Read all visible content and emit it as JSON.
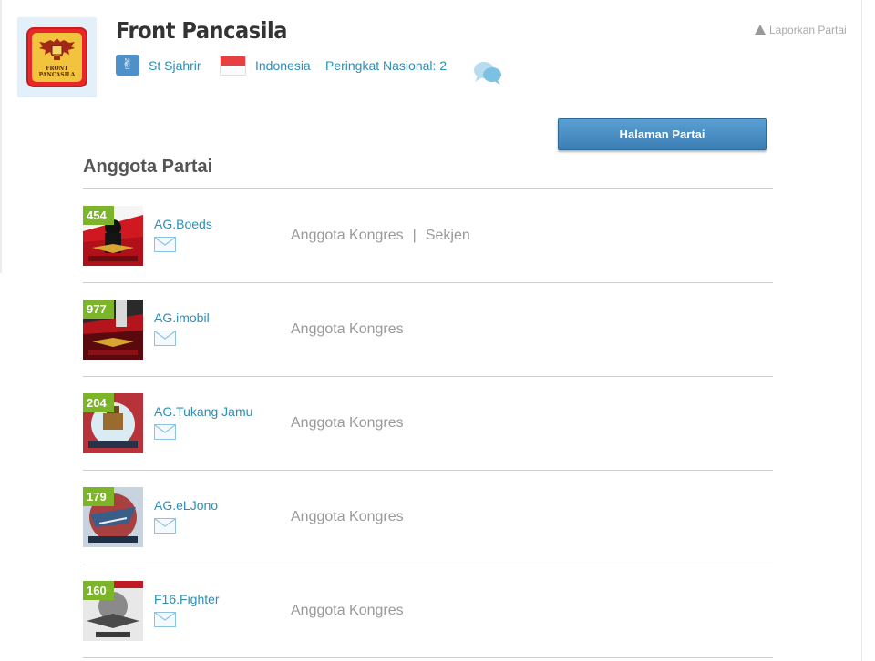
{
  "party": {
    "name": "Front Pancasila",
    "logo_text_line1": "FRONT",
    "logo_text_line2": "PANCASILA",
    "ideology_label": "St Sjahrir",
    "country_label": "Indonesia",
    "rank_label": "Peringkat Nasional: 2",
    "report_label": "Laporkan Partai",
    "party_page_button": "Halaman Partai"
  },
  "members_section": {
    "title": "Anggota Partai"
  },
  "members": [
    {
      "level": "454",
      "name": "AG.Boeds",
      "role": "Anggota Kongres",
      "extra_role": "Sekjen",
      "avatar_color": "#b0101a"
    },
    {
      "level": "977",
      "name": "AG.imobil",
      "role": "Anggota Kongres",
      "extra_role": "",
      "avatar_color": "#7a0c10"
    },
    {
      "level": "204",
      "name": "AG.Tukang Jamu",
      "role": "Anggota Kongres",
      "extra_role": "",
      "avatar_color": "#b8323a"
    },
    {
      "level": "179",
      "name": "AG.eLJono",
      "role": "Anggota Kongres",
      "extra_role": "",
      "avatar_color": "#3a5e8a"
    },
    {
      "level": "160",
      "name": "F16.Fighter",
      "role": "Anggota Kongres",
      "extra_role": "",
      "avatar_color": "#6a6a6a"
    }
  ],
  "colors": {
    "link": "#2c8fb8",
    "button": "#4a90c8",
    "level_badge": "#7cb52a",
    "role_text": "#999999"
  },
  "icons": {
    "ideology": "ideology-v-icon",
    "flag": "indonesia-flag-icon",
    "chat": "chat-bubbles-icon",
    "report": "warning-icon",
    "mail": "mail-envelope-icon"
  }
}
